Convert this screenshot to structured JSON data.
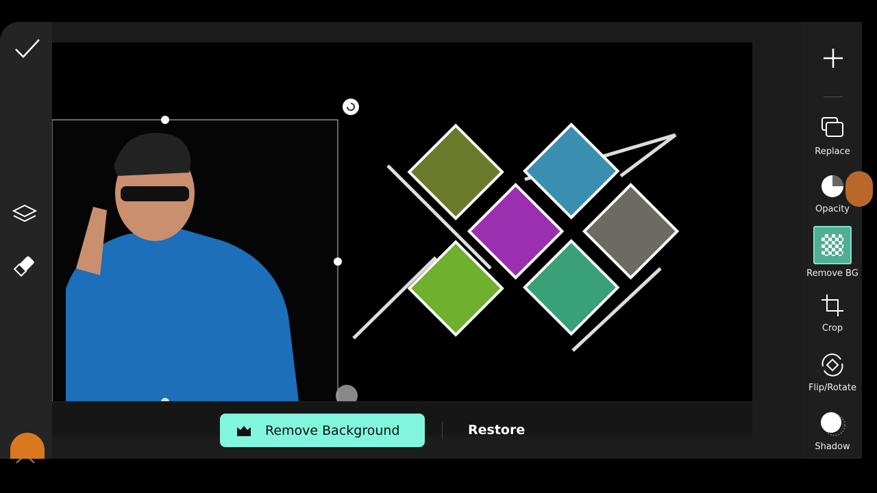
{
  "left_toolbar": {
    "items": [
      {
        "icon": "check-icon"
      },
      {
        "icon": "layers-icon"
      },
      {
        "icon": "eraser-icon"
      },
      {
        "icon": "close-icon"
      }
    ]
  },
  "right_toolbar": {
    "items": [
      {
        "icon": "plus-icon",
        "label": ""
      },
      {
        "icon": "replace-icon",
        "label": "Replace"
      },
      {
        "icon": "opacity-icon",
        "label": "Opacity"
      },
      {
        "icon": "remove-bg-icon",
        "label": "Remove BG",
        "active": true
      },
      {
        "icon": "crop-icon",
        "label": "Crop"
      },
      {
        "icon": "flip-rotate-icon",
        "label": "Flip/Rotate"
      },
      {
        "icon": "shadow-icon",
        "label": "Shadow"
      }
    ]
  },
  "bottom": {
    "remove_bg_label": "Remove Background",
    "restore_label": "Restore"
  },
  "colors": {
    "accent": "#82f5dd",
    "active_tool_bg": "#4fae94"
  }
}
